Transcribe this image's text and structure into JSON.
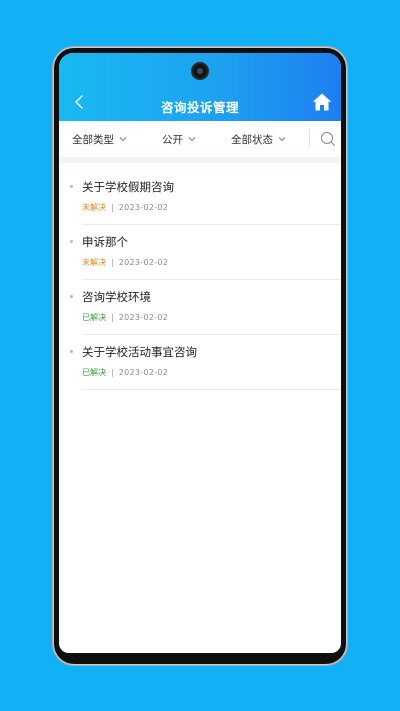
{
  "header": {
    "title": "咨询投诉管理",
    "back_icon": "chevron-left-icon",
    "home_icon": "home-icon"
  },
  "filters": {
    "type_label": "全部类型",
    "visibility_label": "公开",
    "status_label": "全部状态",
    "search_icon": "search-icon"
  },
  "items": [
    {
      "title": "关于学校假期咨询",
      "status": "未解决",
      "separator": "|",
      "date": "2023-02-02"
    },
    {
      "title": "申诉那个",
      "status": "未解决",
      "separator": "|",
      "date": "2023-02-02"
    },
    {
      "title": "咨询学校环境",
      "status": "已解决",
      "separator": "|",
      "date": "2023-02-02"
    },
    {
      "title": "关于学校活动事宜咨询",
      "status": "已解决",
      "separator": "|",
      "date": "2023-02-02"
    }
  ],
  "colors": {
    "background": "#12b0f5",
    "header_start": "#19b9f3",
    "header_end": "#1e7ff0",
    "unresolved": "#d98c1a",
    "resolved": "#3aa13a"
  }
}
